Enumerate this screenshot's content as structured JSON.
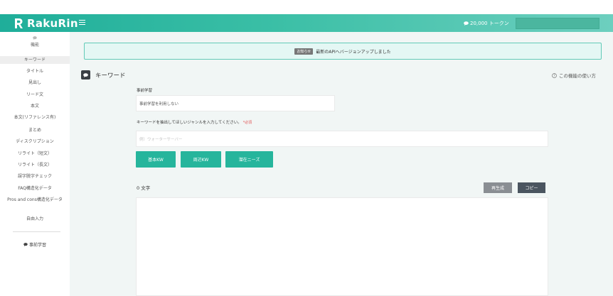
{
  "header": {
    "brand": "RakuRin",
    "tokens": "20,000 トークン",
    "colors": {
      "accent": "#26b59c",
      "accent_light": "#6dcfbf"
    }
  },
  "sidebar": {
    "heading": "機能",
    "items": [
      {
        "label": "キーワード",
        "active": true
      },
      {
        "label": "タイトル"
      },
      {
        "label": "見出し"
      },
      {
        "label": "リード文"
      },
      {
        "label": "本文"
      },
      {
        "label": "本文(リファレンス有)"
      },
      {
        "label": "まとめ"
      },
      {
        "label": "ディスクリプション"
      },
      {
        "label": "リライト（短文）"
      },
      {
        "label": "リライト（長文）"
      },
      {
        "label": "誤字脱字チェック"
      },
      {
        "label": "FAQ構造化データ"
      },
      {
        "label": "Pros and cons構造化データ"
      },
      {
        "label": "自由入力"
      }
    ],
    "dictionary": "事前学習"
  },
  "notice": {
    "badge": "お知らせ",
    "text": "最新のAPIへバージョンアップしました"
  },
  "section": {
    "title": "キーワード",
    "help": "この機能の使い方"
  },
  "form": {
    "pretrain_label": "事前学習",
    "pretrain_value": "事前学習を利用しない",
    "genre_label": "キーワードを抽出してほしいジャンルを入力してください。",
    "required": "*必須",
    "genre_placeholder": "例）ウォーターサーバー"
  },
  "buttons": {
    "basic_kw": "基本KW",
    "related_kw": "周辺KW",
    "latent_needs": "潜在ニーズ",
    "regenerate": "再生成",
    "copy": "コピー"
  },
  "output": {
    "char_count": "0 文字"
  }
}
